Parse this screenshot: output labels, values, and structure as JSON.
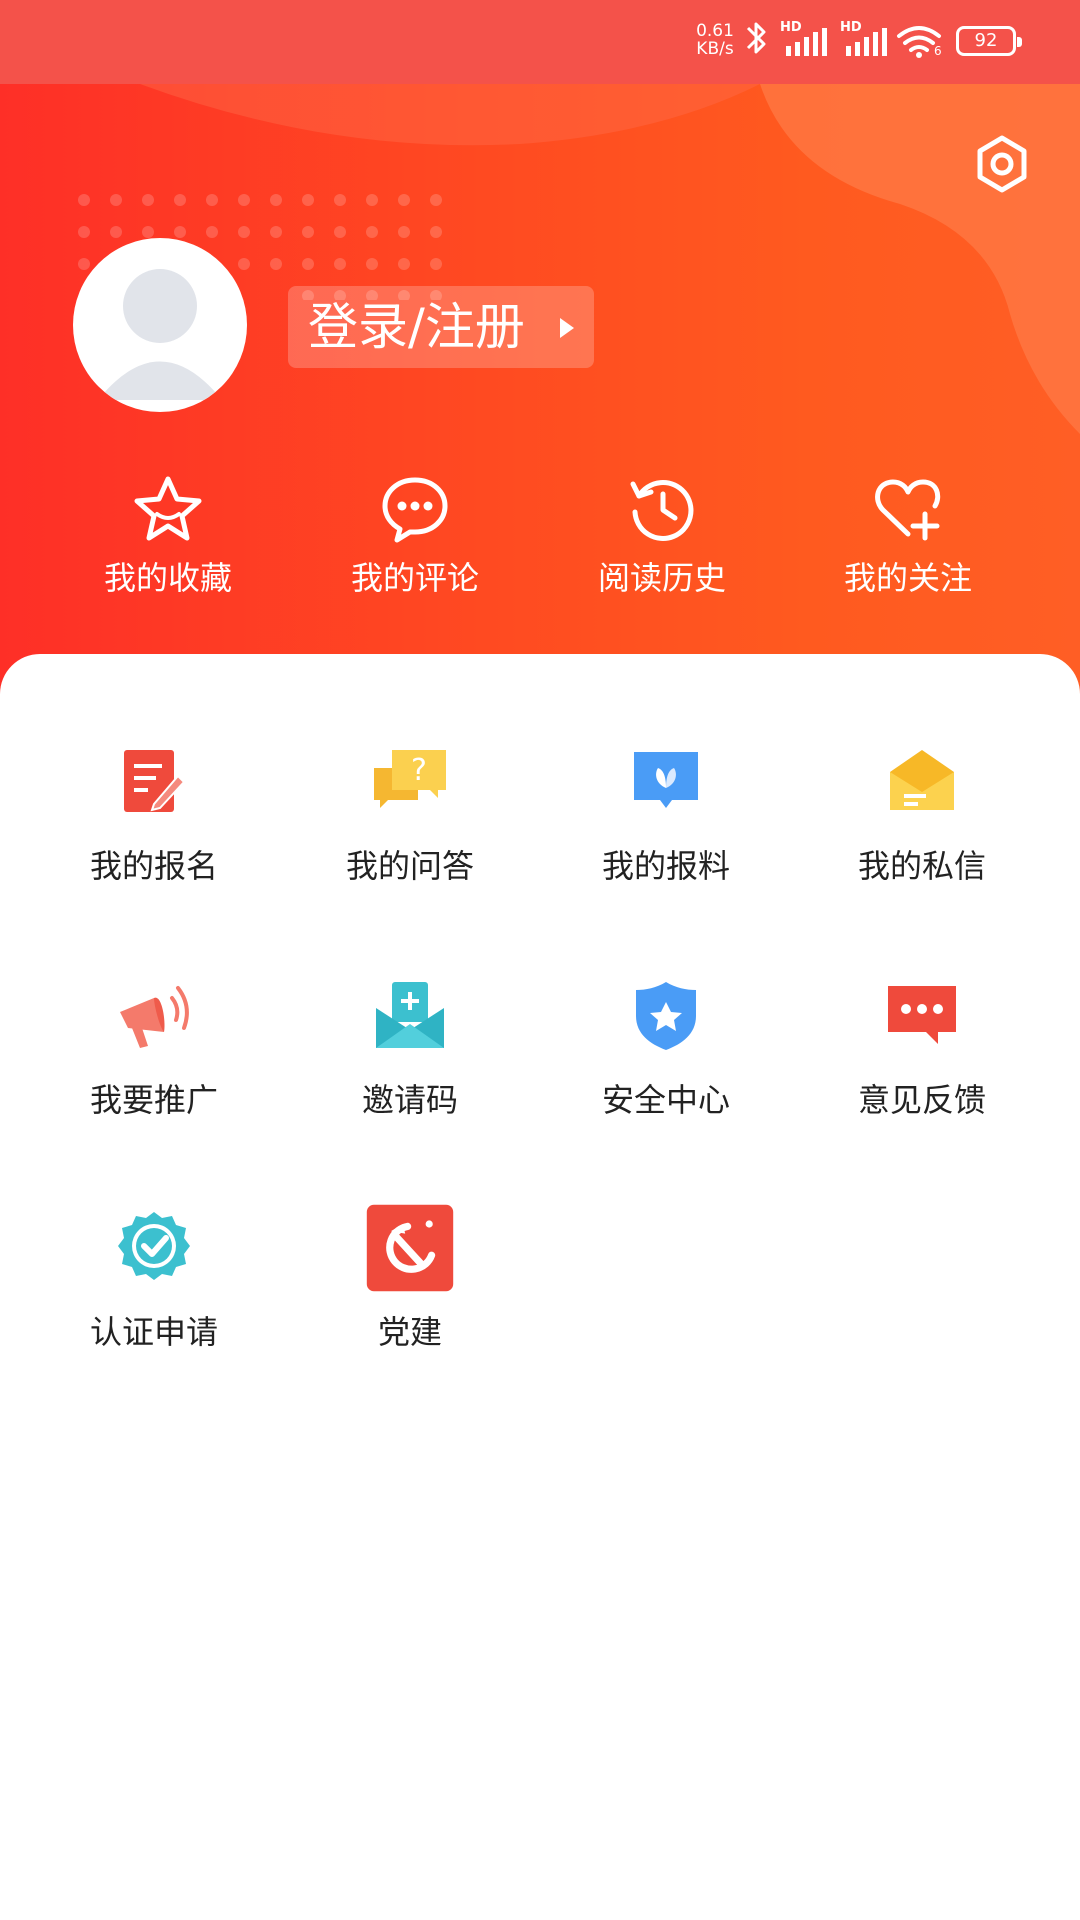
{
  "status_bar": {
    "net_speed_value": "0.61",
    "net_speed_unit": "KB/s",
    "battery": "92",
    "signal_1_label": "HD",
    "signal_2_label": "HD",
    "wifi_badge": "6"
  },
  "profile": {
    "login_label": "登录/注册"
  },
  "quick_actions": [
    {
      "label": "我的收藏",
      "icon": "star-icon"
    },
    {
      "label": "我的评论",
      "icon": "comment-icon"
    },
    {
      "label": "阅读历史",
      "icon": "history-icon"
    },
    {
      "label": "我的关注",
      "icon": "heart-plus-icon"
    }
  ],
  "menu_items": [
    {
      "label": "我的报名",
      "icon": "signup-icon"
    },
    {
      "label": "我的问答",
      "icon": "qa-icon"
    },
    {
      "label": "我的报料",
      "icon": "report-icon"
    },
    {
      "label": "我的私信",
      "icon": "message-icon"
    },
    {
      "label": "我要推广",
      "icon": "megaphone-icon"
    },
    {
      "label": "邀请码",
      "icon": "invite-icon"
    },
    {
      "label": "安全中心",
      "icon": "shield-icon"
    },
    {
      "label": "意见反馈",
      "icon": "feedback-icon"
    },
    {
      "label": "认证申请",
      "icon": "verified-icon"
    },
    {
      "label": "党建",
      "icon": "party-icon"
    }
  ],
  "colors": {
    "header_start": "#fe2f27",
    "header_end": "#ff5e25",
    "status_bar": "#f4524a",
    "menu_text": "#222222"
  }
}
